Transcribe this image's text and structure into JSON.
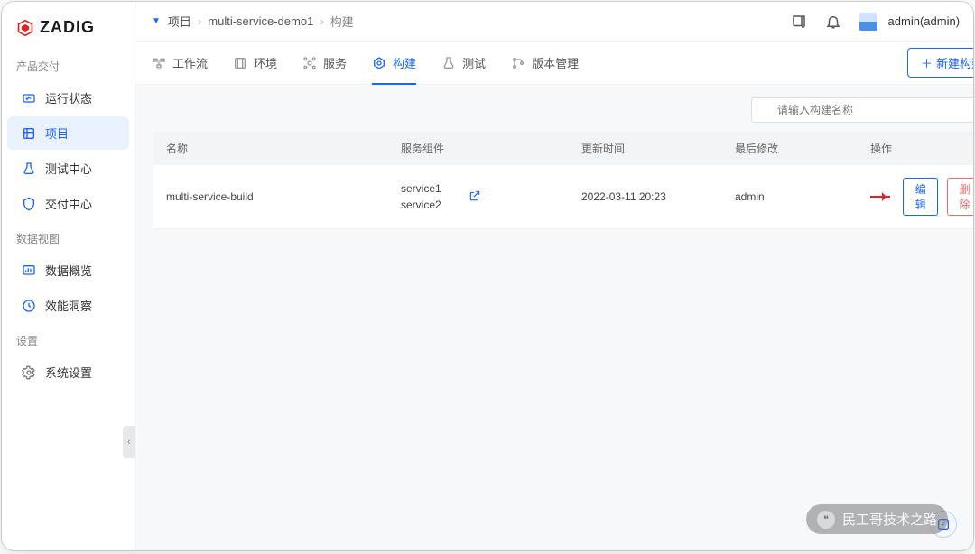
{
  "brand": "ZADIG",
  "breadcrumb": {
    "items": [
      "项目",
      "multi-service-demo1",
      "构建"
    ]
  },
  "user": {
    "display": "admin(admin)"
  },
  "sidebar": {
    "groups": [
      {
        "title": "产品交付",
        "items": [
          {
            "label": "运行状态",
            "icon": "status"
          },
          {
            "label": "项目",
            "icon": "project",
            "active": true
          },
          {
            "label": "测试中心",
            "icon": "test"
          },
          {
            "label": "交付中心",
            "icon": "delivery"
          }
        ]
      },
      {
        "title": "数据视图",
        "items": [
          {
            "label": "数据概览",
            "icon": "overview"
          },
          {
            "label": "效能洞察",
            "icon": "insight"
          }
        ]
      },
      {
        "title": "设置",
        "items": [
          {
            "label": "系统设置",
            "icon": "settings"
          }
        ]
      }
    ]
  },
  "tabs": [
    {
      "label": "工作流",
      "icon": "workflow"
    },
    {
      "label": "环境",
      "icon": "env"
    },
    {
      "label": "服务",
      "icon": "service"
    },
    {
      "label": "构建",
      "icon": "build",
      "active": true
    },
    {
      "label": "测试",
      "icon": "flask"
    },
    {
      "label": "版本管理",
      "icon": "version"
    }
  ],
  "new_build_label": "新建构建",
  "search": {
    "placeholder": "请输入构建名称"
  },
  "table": {
    "headers": [
      "名称",
      "服务组件",
      "更新时间",
      "最后修改",
      "操作"
    ],
    "rows": [
      {
        "name": "multi-service-build",
        "services": [
          "service1",
          "service2"
        ],
        "updated": "2022-03-11 20:23",
        "modifier": "admin",
        "edit_label": "编辑",
        "delete_label": "删除"
      }
    ]
  },
  "watermark": "民工哥技术之路"
}
